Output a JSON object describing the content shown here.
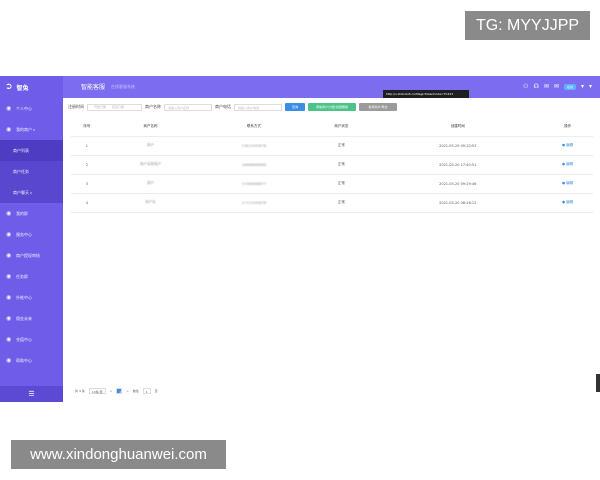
{
  "watermark": {
    "tg": "TG: MYYJJPP",
    "site": "www.xindonghuanwei.com"
  },
  "sidebar": {
    "logo": "智兔",
    "items": [
      {
        "label": "个人中心",
        "icon": "home-icon"
      },
      {
        "label": "我的商户",
        "icon": "message-icon",
        "sup": "0"
      },
      {
        "label": "商户列表",
        "sub": true,
        "active": true
      },
      {
        "label": "商户任务",
        "sub": true
      },
      {
        "label": "商户聊天",
        "sub": true,
        "sup": "0"
      },
      {
        "label": "我的群",
        "icon": "group-icon"
      },
      {
        "label": "服务中心",
        "icon": "send-icon"
      },
      {
        "label": "商户提现审核",
        "icon": "info-icon"
      },
      {
        "label": "任务群",
        "icon": "task-icon"
      },
      {
        "label": "外推中心",
        "icon": "share-icon"
      },
      {
        "label": "佣金未来",
        "icon": "money-icon"
      },
      {
        "label": "充值中心",
        "icon": "phone-icon"
      },
      {
        "label": "帮助中心",
        "icon": "help-icon"
      }
    ],
    "collapse": "☰"
  },
  "topbar": {
    "title": "智能客服",
    "subtitle": "在线客服系统",
    "pill": "在线"
  },
  "tooltip": "http://s.zhikutu5.cn/MagicTokenCode=7C417",
  "filters": {
    "date_label": "注册时间",
    "date_start": "开始日期",
    "date_end": "结束日期",
    "name_label": "商户名称",
    "name_placeholder": "请输入商户名称",
    "phone_label": "商户电话",
    "phone_placeholder": "请输入商户电话",
    "search": "查询",
    "btn_green": "添加商户/分配/批量删除",
    "btn_gray": "新增商户/导出"
  },
  "table": {
    "headers": [
      "序号",
      "商户名称",
      "联系方式",
      "商户状态",
      "创建时间",
      "操作"
    ],
    "rows": [
      {
        "no": "1",
        "name": "商户",
        "contact": "13812345678",
        "status": "正常",
        "time": "2021-05-29 09:20:53",
        "op": "● 编辑"
      },
      {
        "no": "2",
        "name": "商户名称商户",
        "contact": "18888888888",
        "status": "正常",
        "time": "2021-05-20 17:40:51",
        "op": "● 编辑"
      },
      {
        "no": "3",
        "name": "商户",
        "contact": "13366668877",
        "status": "正常",
        "time": "2021-05-20 09:29:46",
        "op": "● 编辑"
      },
      {
        "no": "4",
        "name": "商户名",
        "contact": "17712345678",
        "status": "正常",
        "time": "2021-05-20 08:26:12",
        "op": "● 编辑"
      }
    ]
  },
  "pager": {
    "total": "共 4 条",
    "size": "10条/页",
    "prev": "<",
    "page": "1",
    "next": ">",
    "goto": "前往",
    "goto_page": "1",
    "unit": "页"
  }
}
